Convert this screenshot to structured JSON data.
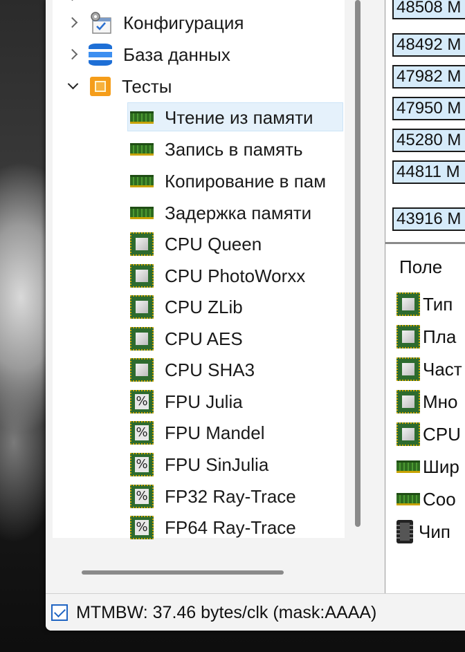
{
  "tree": {
    "items": [
      {
        "label": "Конфигурация",
        "icon": "config-icon",
        "expanded": false
      },
      {
        "label": "База данных",
        "icon": "database-icon",
        "expanded": false
      },
      {
        "label": "Тесты",
        "icon": "tests-icon",
        "expanded": true
      }
    ],
    "tests": [
      {
        "label": "Чтение из памяти",
        "icon": "ram-icon",
        "selected": true
      },
      {
        "label": "Запись в память",
        "icon": "ram-icon"
      },
      {
        "label": "Копирование в пам",
        "icon": "ram-icon"
      },
      {
        "label": "Задержка памяти",
        "icon": "ram-icon"
      },
      {
        "label": "CPU Queen",
        "icon": "cpu-icon"
      },
      {
        "label": "CPU PhotoWorxx",
        "icon": "cpu-icon"
      },
      {
        "label": "CPU ZLib",
        "icon": "cpu-icon"
      },
      {
        "label": "CPU AES",
        "icon": "cpu-icon"
      },
      {
        "label": "CPU SHA3",
        "icon": "cpu-icon"
      },
      {
        "label": "FPU Julia",
        "icon": "fpu-icon"
      },
      {
        "label": "FPU Mandel",
        "icon": "fpu-icon"
      },
      {
        "label": "FPU SinJulia",
        "icon": "fpu-icon"
      },
      {
        "label": "FP32 Ray-Trace",
        "icon": "fpu-icon"
      },
      {
        "label": "FP64 Ray-Trace",
        "icon": "fpu-icon"
      }
    ]
  },
  "results": {
    "values": [
      "48508 M",
      "48492 M",
      "47982 M",
      "47950 M",
      "45280 M",
      "44811 M",
      "43916 M"
    ]
  },
  "fields": {
    "header": "Поле",
    "rows": [
      {
        "label": "Тип",
        "icon": "cpu-icon"
      },
      {
        "label": "Пла",
        "icon": "cpu-icon"
      },
      {
        "label": "Част",
        "icon": "cpu-icon"
      },
      {
        "label": "Мно",
        "icon": "cpu-icon"
      },
      {
        "label": "CPU",
        "icon": "cpu-icon"
      },
      {
        "label": "Шир",
        "icon": "ram-icon"
      },
      {
        "label": "Соо",
        "icon": "ram-icon"
      },
      {
        "label": "Чип",
        "icon": "chip-icon"
      }
    ]
  },
  "status": {
    "text": "MTMBW: 37.46 bytes/clk (mask:AAAA)",
    "checked": true
  }
}
